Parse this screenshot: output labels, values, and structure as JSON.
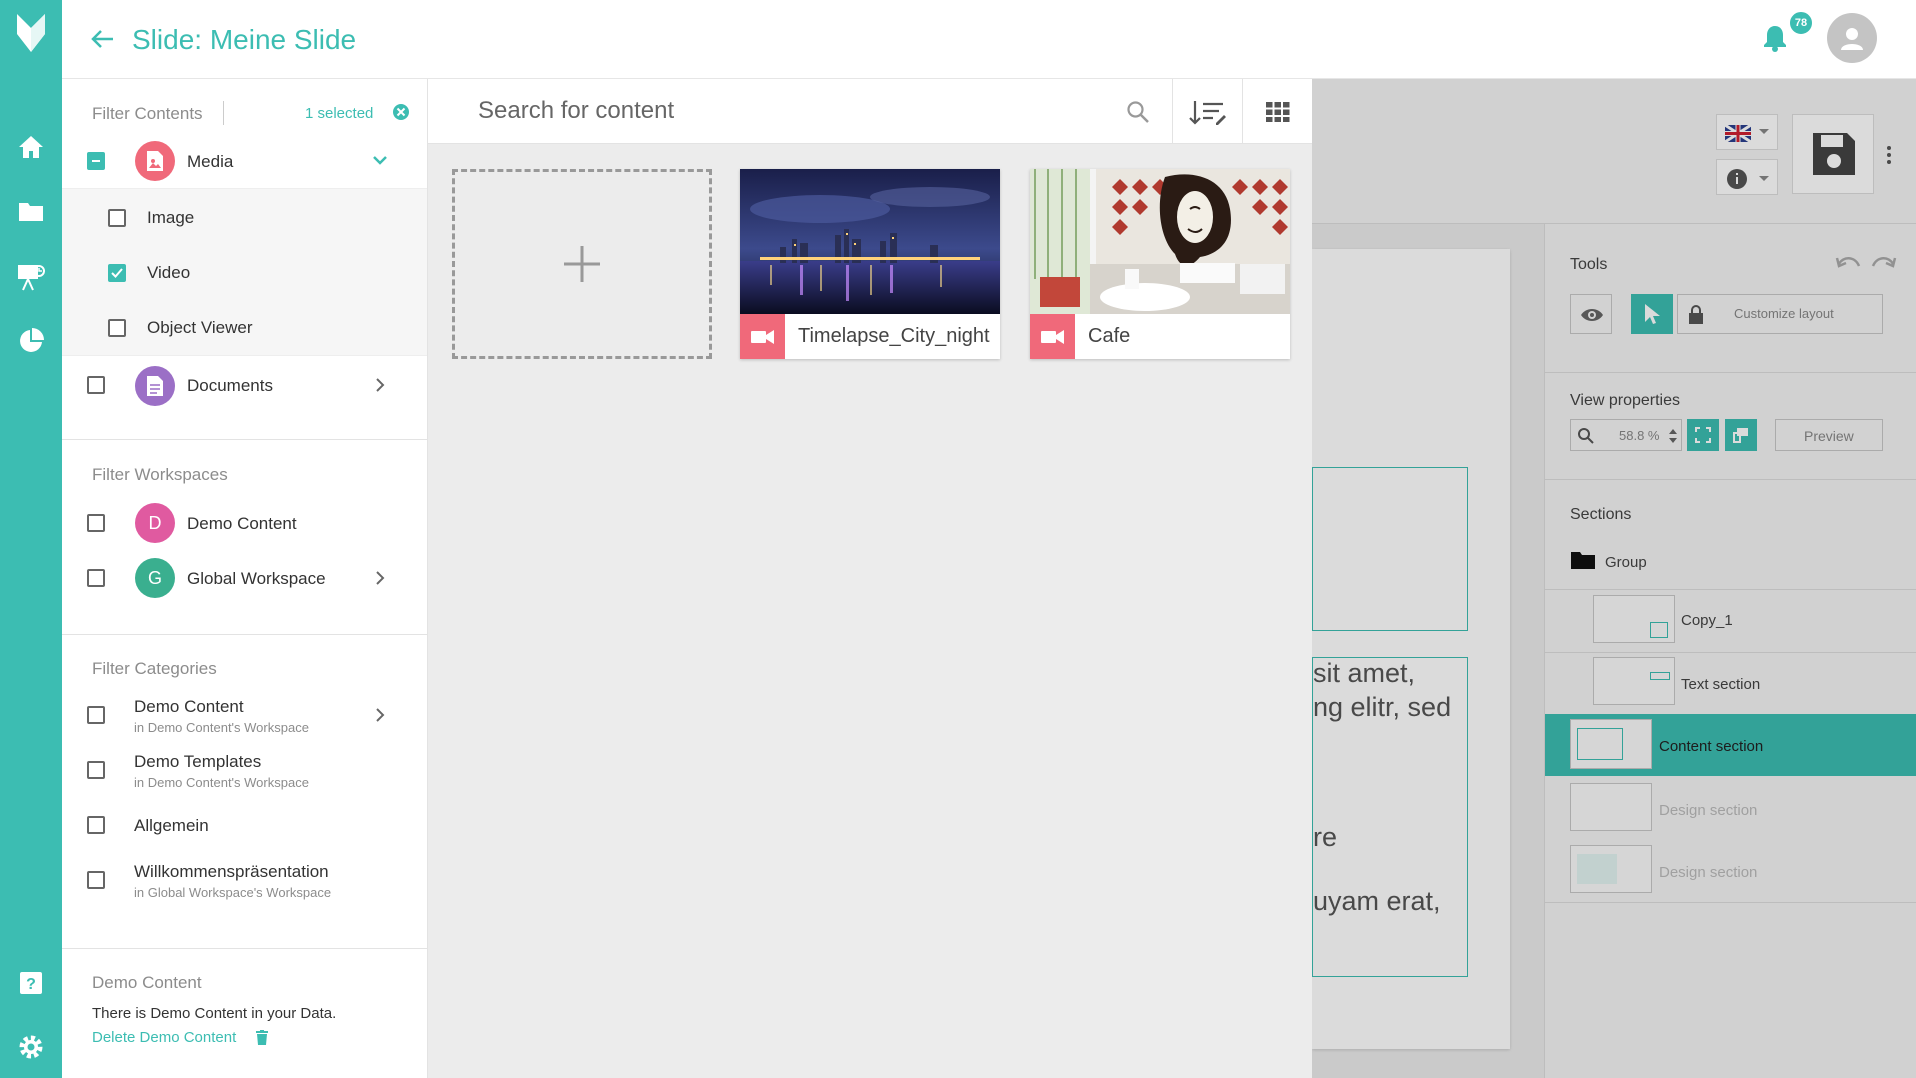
{
  "header": {
    "title": "Slide: Meine Slide",
    "notification_count": "78"
  },
  "rail": {
    "items": [
      "logo-icon",
      "home-icon",
      "folder-icon",
      "presentation-icon",
      "pie-chart-icon",
      "help-icon",
      "settings-icon"
    ]
  },
  "filter": {
    "contents_label": "Filter Contents",
    "selected_label": "1 selected",
    "media": {
      "label": "Media",
      "children": [
        {
          "label": "Image",
          "checked": false
        },
        {
          "label": "Video",
          "checked": true
        },
        {
          "label": "Object Viewer",
          "checked": false
        }
      ]
    },
    "documents_label": "Documents",
    "workspaces_label": "Filter Workspaces",
    "workspaces": [
      {
        "initial": "D",
        "label": "Demo Content",
        "color": "#e05aa0"
      },
      {
        "initial": "G",
        "label": "Global Workspace",
        "color": "#3aaf8f"
      }
    ],
    "categories_label": "Filter Categories",
    "categories": [
      {
        "label": "Demo Content",
        "sub": "in Demo Content's Workspace"
      },
      {
        "label": "Demo Templates",
        "sub": "in Demo Content's Workspace"
      },
      {
        "label": "Allgemein",
        "sub": ""
      },
      {
        "label": "Willkommenspräsentation",
        "sub": "in Global Workspace's Workspace"
      }
    ],
    "demo": {
      "title": "Demo Content",
      "text": "There is Demo Content in your Data.",
      "delete_label": "Delete Demo Content"
    }
  },
  "content": {
    "search_placeholder": "Search for content",
    "cards": [
      {
        "title": "Timelapse_City_night",
        "type": "video"
      },
      {
        "title": "Cafe",
        "type": "video"
      }
    ]
  },
  "editor": {
    "tools_label": "Tools",
    "customize_label": "Customize layout",
    "view_props_label": "View properties",
    "zoom_value": "58.8 %",
    "preview_label": "Preview",
    "sections_label": "Sections",
    "group_label": "Group",
    "sections": [
      {
        "label": "Copy_1"
      },
      {
        "label": "Text section"
      },
      {
        "label": "Content section"
      },
      {
        "label": "Design section"
      },
      {
        "label": "Design section"
      }
    ],
    "canvas_text": [
      "sit amet,",
      "ng elitr, sed",
      "re",
      "uyam erat,"
    ]
  },
  "colors": {
    "accent": "#3cbdb2",
    "media_red": "#f0697a",
    "documents_purple": "#9b6fc6"
  }
}
